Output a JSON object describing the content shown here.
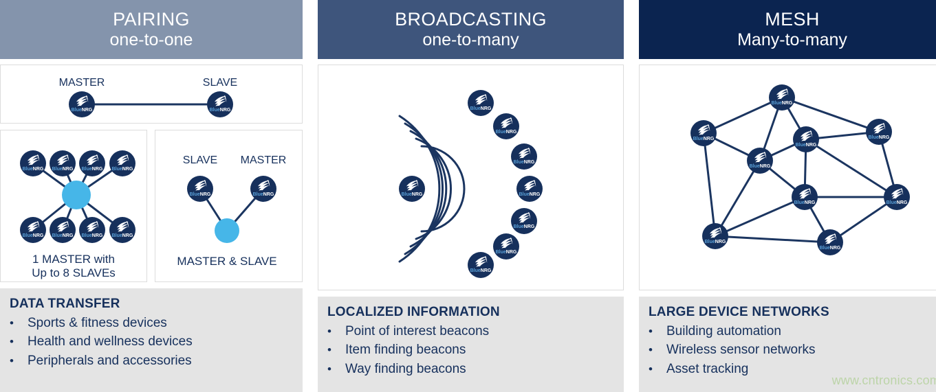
{
  "columns": [
    {
      "key": "pairing",
      "banner": {
        "title": "PAIRING",
        "subtitle": "one-to-one",
        "color": "#8494ac"
      },
      "diagrams": {
        "top": {
          "labels": {
            "left": "MASTER",
            "right": "SLAVE"
          }
        },
        "star": {
          "caption_line1": "1 MASTER with",
          "caption_line2": "Up to 8 SLAVEs",
          "slave_count": 8,
          "master_count": 1
        },
        "triangle": {
          "labels": {
            "left": "SLAVE",
            "right": "MASTER"
          },
          "caption": "MASTER & SLAVE"
        }
      },
      "info": {
        "heading": "DATA TRANSFER",
        "bullet": "•",
        "items": [
          "Sports & fitness devices",
          "Health and wellness devices",
          "Peripherals and accessories"
        ]
      }
    },
    {
      "key": "broadcasting",
      "banner": {
        "title": "BROADCASTING",
        "subtitle": "one-to-many",
        "color": "#3e557c"
      },
      "diagrams": {
        "broadcast": {
          "broadcaster_count": 1,
          "receiver_count": 7,
          "wave_arc_count": 5
        }
      },
      "info": {
        "heading": "LOCALIZED INFORMATION",
        "bullet": "•",
        "items": [
          "Point of interest beacons",
          "Item finding beacons",
          "Way finding beacons"
        ]
      }
    },
    {
      "key": "mesh",
      "banner": {
        "title": "MESH",
        "subtitle": "Many-to-many",
        "color": "#0b2450"
      },
      "diagrams": {
        "mesh": {
          "node_count": 9,
          "link_count": 18
        }
      },
      "info": {
        "heading": "LARGE DEVICE NETWORKS",
        "bullet": "•",
        "items": [
          "Building automation",
          "Wireless sensor networks",
          "Asset tracking"
        ]
      }
    }
  ],
  "node": {
    "brand_prefix": "Blue",
    "brand_suffix": "NRG",
    "icon": "bluenrg-wing-icon"
  },
  "watermark": "www.cntronics.com",
  "colors": {
    "node_navy": "#16305c",
    "link_navy": "#1b3560",
    "hub_blue": "#46b6e8",
    "text_navy": "#16305c",
    "info_bg": "#e4e4e4",
    "box_border": "#dcdcdc",
    "watermark": "#bcd4a8"
  }
}
